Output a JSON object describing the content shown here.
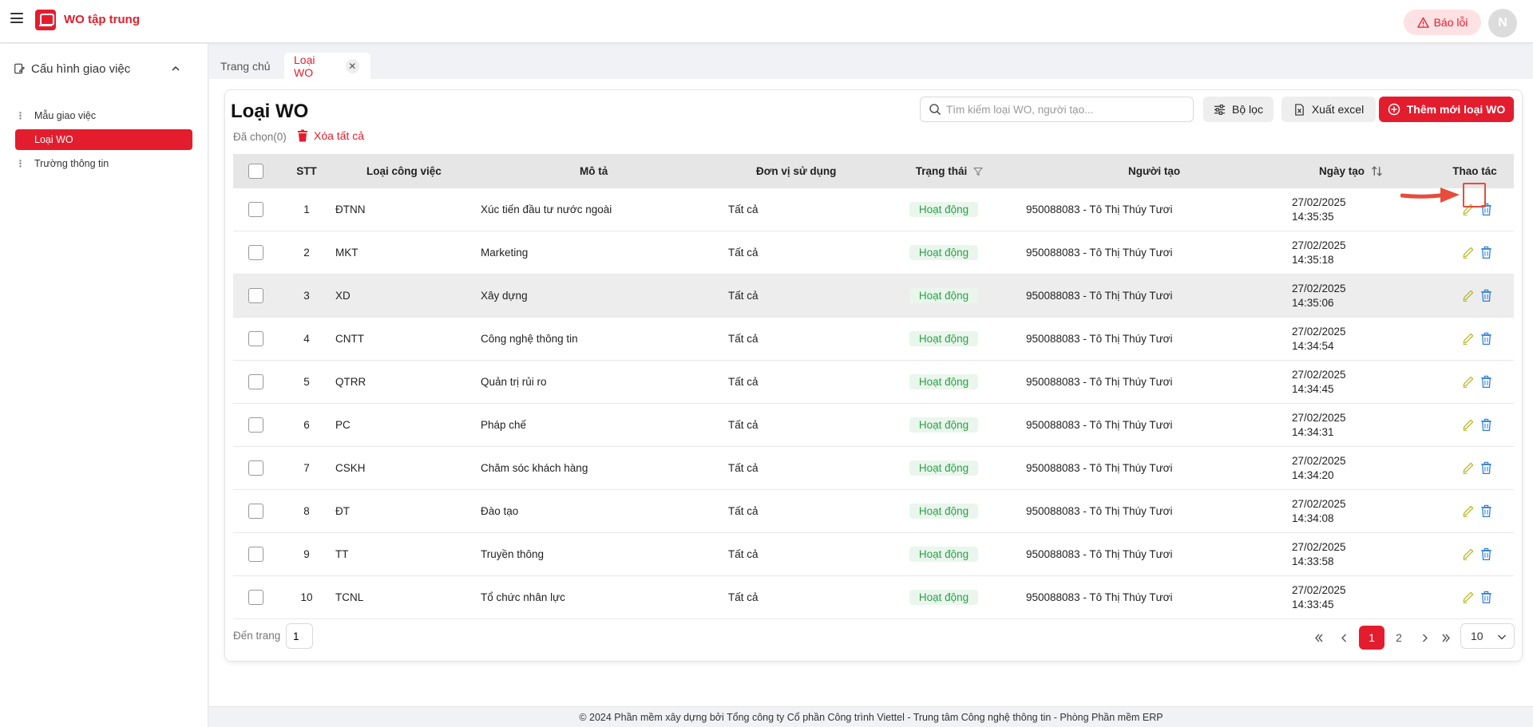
{
  "header": {
    "app_title": "WO tập trung",
    "report_label": "Báo lỗi",
    "avatar_initial": "N",
    "brand_color": "#e31d2e"
  },
  "sidebar": {
    "group_label": "Cấu hình giao việc",
    "items": [
      {
        "label": "Mẫu giao việc",
        "active": false
      },
      {
        "label": "Loại WO",
        "active": true
      },
      {
        "label": "Trường thông tin",
        "active": false
      }
    ]
  },
  "tabs": [
    {
      "label": "Trang chủ"
    },
    {
      "label": "Loại WO",
      "closable": true
    }
  ],
  "page": {
    "title": "Loại WO",
    "selected_text": "Đã chọn(0)",
    "delete_all_label": "Xóa tất cả",
    "search_placeholder": "Tìm kiếm loại WO, người tạo...",
    "filter_label": "Bộ lọc",
    "export_label": "Xuất excel",
    "add_label": "Thêm mới loại WO"
  },
  "table": {
    "columns": [
      "STT",
      "Loại công việc",
      "Mô tả",
      "Đơn vị sử dụng",
      "Trạng thái",
      "Người tạo",
      "Ngày tạo",
      "Thao tác"
    ],
    "rows": [
      {
        "stt": "1",
        "type": "ĐTNN",
        "desc": "Xúc tiến đầu tư nước ngoài",
        "unit": "Tất cả",
        "status": "Hoạt động",
        "creator": "950088083 - Tô Thị Thúy Tươi",
        "date": "27/02/2025",
        "time": "14:35:35"
      },
      {
        "stt": "2",
        "type": "MKT",
        "desc": "Marketing",
        "unit": "Tất cả",
        "status": "Hoạt động",
        "creator": "950088083 - Tô Thị Thúy Tươi",
        "date": "27/02/2025",
        "time": "14:35:18"
      },
      {
        "stt": "3",
        "type": "XD",
        "desc": "Xây dựng",
        "unit": "Tất cả",
        "status": "Hoạt động",
        "creator": "950088083 - Tô Thị Thúy Tươi",
        "date": "27/02/2025",
        "time": "14:35:06"
      },
      {
        "stt": "4",
        "type": "CNTT",
        "desc": "Công nghệ thông tin",
        "unit": "Tất cả",
        "status": "Hoạt động",
        "creator": "950088083 - Tô Thị Thúy Tươi",
        "date": "27/02/2025",
        "time": "14:34:54"
      },
      {
        "stt": "5",
        "type": "QTRR",
        "desc": "Quản trị rủi ro",
        "unit": "Tất cả",
        "status": "Hoạt động",
        "creator": "950088083 - Tô Thị Thúy Tươi",
        "date": "27/02/2025",
        "time": "14:34:45"
      },
      {
        "stt": "6",
        "type": "PC",
        "desc": "Pháp chế",
        "unit": "Tất cả",
        "status": "Hoạt động",
        "creator": "950088083 - Tô Thị Thúy Tươi",
        "date": "27/02/2025",
        "time": "14:34:31"
      },
      {
        "stt": "7",
        "type": "CSKH",
        "desc": "Chăm sóc khách hàng",
        "unit": "Tất cả",
        "status": "Hoạt động",
        "creator": "950088083 - Tô Thị Thúy Tươi",
        "date": "27/02/2025",
        "time": "14:34:20"
      },
      {
        "stt": "8",
        "type": "ĐT",
        "desc": "Đào tạo",
        "unit": "Tất cả",
        "status": "Hoạt động",
        "creator": "950088083 - Tô Thị Thúy Tươi",
        "date": "27/02/2025",
        "time": "14:34:08"
      },
      {
        "stt": "9",
        "type": "TT",
        "desc": "Truyền thông",
        "unit": "Tất cả",
        "status": "Hoạt động",
        "creator": "950088083 - Tô Thị Thúy Tươi",
        "date": "27/02/2025",
        "time": "14:33:58"
      },
      {
        "stt": "10",
        "type": "TCNL",
        "desc": "Tổ chức nhân lực",
        "unit": "Tất cả",
        "status": "Hoạt động",
        "creator": "950088083 - Tô Thị Thúy Tươi",
        "date": "27/02/2025",
        "time": "14:33:45"
      }
    ],
    "highlighted_row": 2,
    "status_color": "#2aa14d"
  },
  "pagination": {
    "goto_label": "Đến trang",
    "goto_value": "1",
    "pages": [
      "1",
      "2"
    ],
    "current_page": "1",
    "page_size": "10"
  },
  "footer": {
    "text": "© 2024 Phần mềm xây dựng bởi Tổng công ty Cổ phần Công trình Viettel - Trung tâm Công nghệ thông tin - Phòng Phần mềm ERP"
  }
}
